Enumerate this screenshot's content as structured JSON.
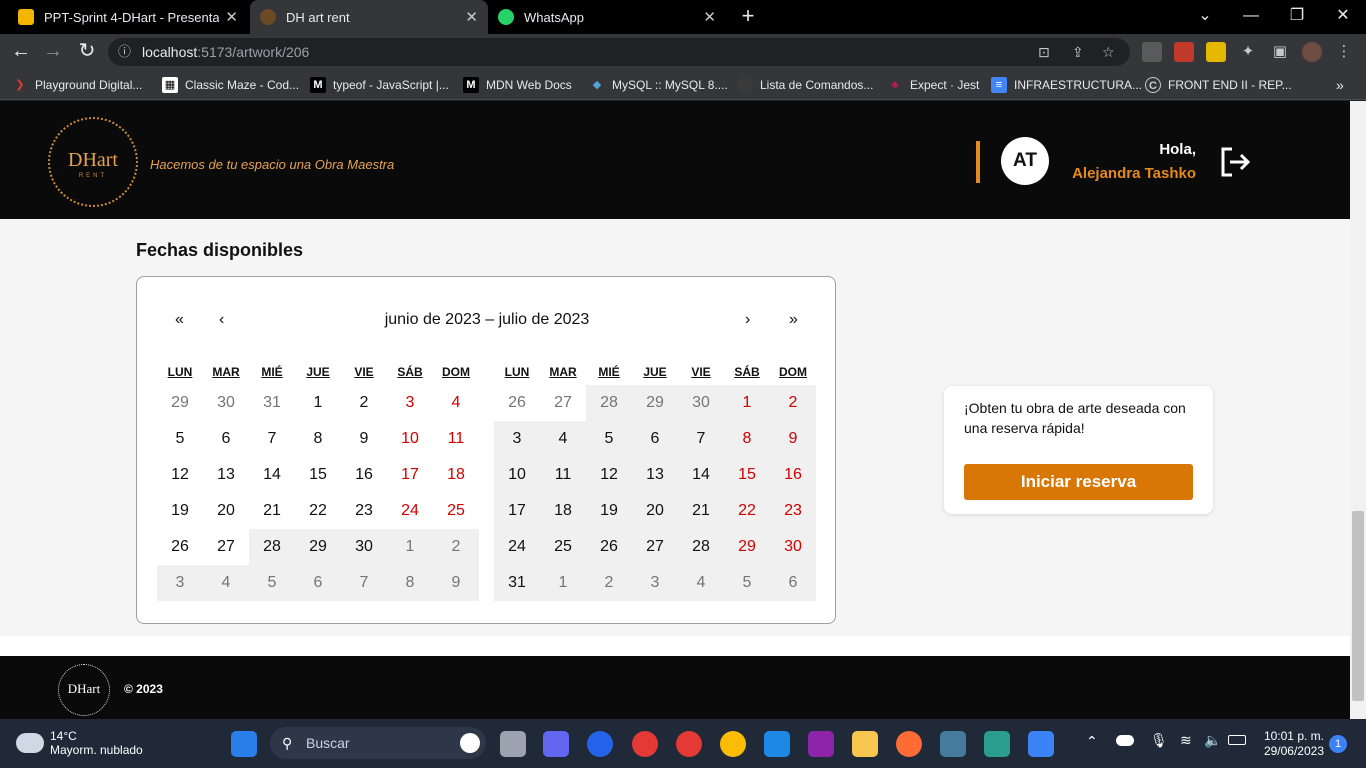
{
  "browser": {
    "tabs": [
      {
        "title": "PPT-Sprint 4-DHart - Presentación",
        "color": "#f4b400"
      },
      {
        "title": "DH art rent",
        "color": "#c98a3e"
      },
      {
        "title": "WhatsApp",
        "color": "#25d366"
      }
    ],
    "url_host": "localhost",
    "url_path": ":5173/artwork/206",
    "bookmarks": [
      "Playground Digital...",
      "Classic Maze - Cod...",
      "typeof - JavaScript |...",
      "MDN Web Docs",
      "MySQL :: MySQL 8....",
      "Lista de Comandos...",
      "Expect · Jest",
      "INFRAESTRUCTURA...",
      "FRONT END II - REP..."
    ]
  },
  "header": {
    "logo_text": "DHart",
    "logo_sub": "RENT",
    "slogan": "Hacemos de tu espacio una Obra Maestra",
    "avatar_initials": "AT",
    "greeting": "Hola,",
    "user_name": "Alejandra Tashko",
    "accent": "#e58a1e"
  },
  "calendar": {
    "section_title": "Fechas disponibles",
    "nav": {
      "first": "«",
      "prev": "‹",
      "next": "›",
      "last": "»"
    },
    "range_label": "junio de 2023 – julio de 2023",
    "weekdays": [
      "LUN",
      "MAR",
      "MIÉ",
      "JUE",
      "VIE",
      "SÁB",
      "DOM"
    ],
    "months": [
      {
        "weeks": [
          [
            "29",
            "30",
            "31",
            "1",
            "2",
            "3",
            "4"
          ],
          [
            "5",
            "6",
            "7",
            "8",
            "9",
            "10",
            "11"
          ],
          [
            "12",
            "13",
            "14",
            "15",
            "16",
            "17",
            "18"
          ],
          [
            "19",
            "20",
            "21",
            "22",
            "23",
            "24",
            "25"
          ],
          [
            "26",
            "27",
            "28",
            "29",
            "30",
            "1",
            "2"
          ],
          [
            "3",
            "4",
            "5",
            "6",
            "7",
            "8",
            "9"
          ]
        ],
        "first_in_month": 3,
        "days_in_month": 30,
        "first_disabled": 30
      },
      {
        "weeks": [
          [
            "26",
            "27",
            "28",
            "29",
            "30",
            "1",
            "2"
          ],
          [
            "3",
            "4",
            "5",
            "6",
            "7",
            "8",
            "9"
          ],
          [
            "10",
            "11",
            "12",
            "13",
            "14",
            "15",
            "16"
          ],
          [
            "17",
            "18",
            "19",
            "20",
            "21",
            "22",
            "23"
          ],
          [
            "24",
            "25",
            "26",
            "27",
            "28",
            "29",
            "30"
          ],
          [
            "31",
            "1",
            "2",
            "3",
            "4",
            "5",
            "6"
          ]
        ],
        "first_in_month": 5,
        "days_in_month": 31,
        "first_disabled": 2
      }
    ],
    "weekend_color": "#d10000"
  },
  "reservation": {
    "text": "¡Obten tu obra de arte deseada con una reserva rápida!",
    "button": "Iniciar reserva",
    "button_color": "#d97706"
  },
  "footer": {
    "logo_text": "DHart",
    "copyright": "© 2023"
  },
  "taskbar": {
    "temp": "14°C",
    "weather": "Mayorm. nublado",
    "search": "Buscar",
    "time": "10:01 p. m.",
    "date": "29/06/2023",
    "notifications": "1"
  }
}
